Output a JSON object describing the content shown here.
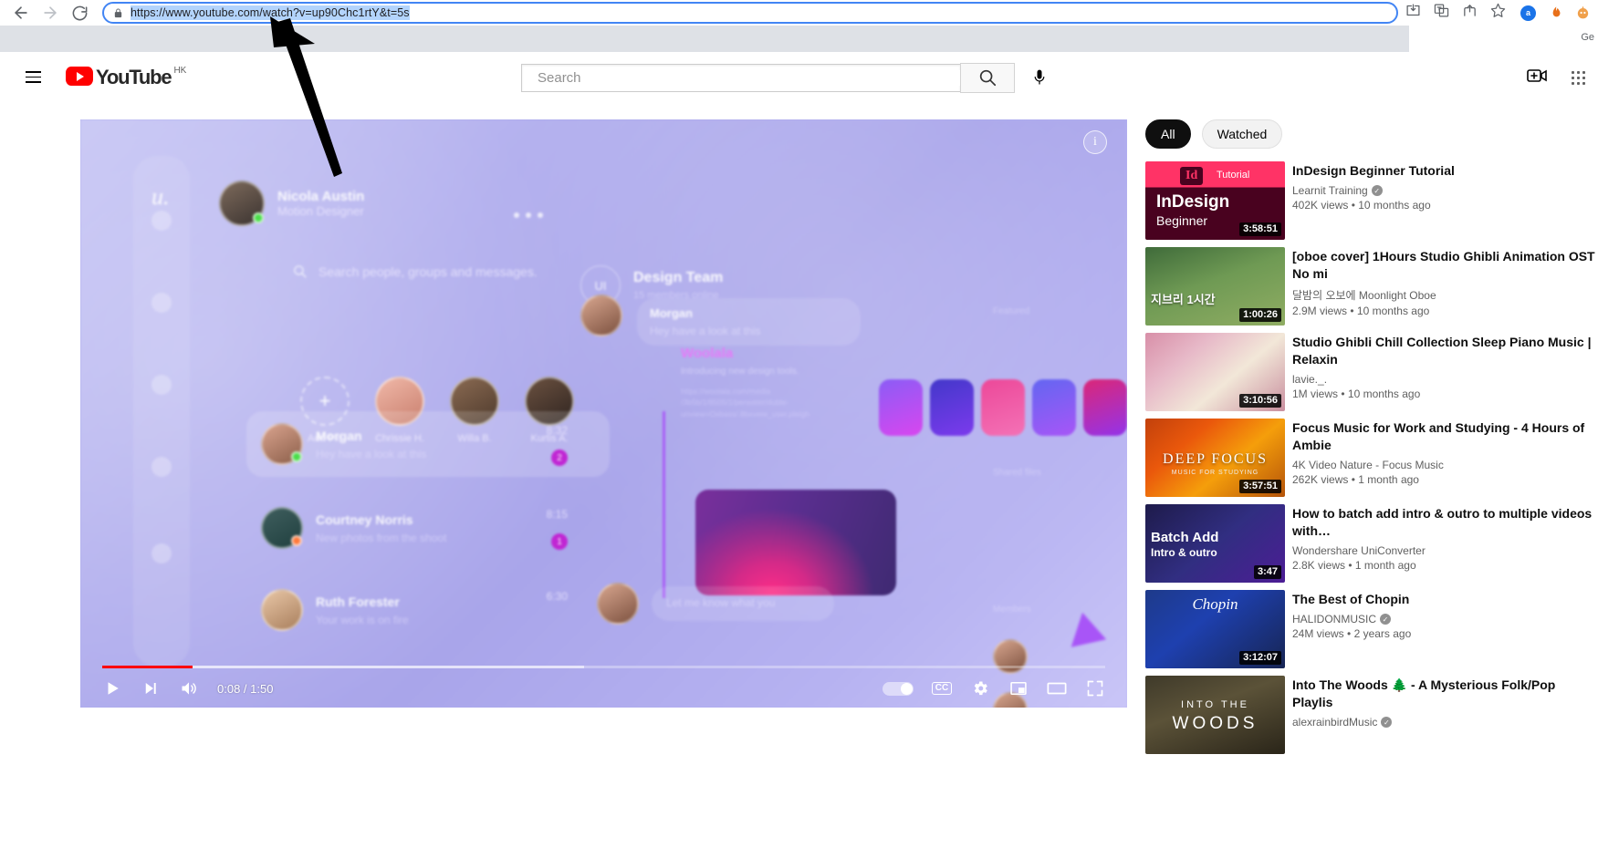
{
  "browser": {
    "url": "https://www.youtube.com/watch?v=up90Chc1rtY&t=5s",
    "back_label": "Back",
    "forward_label": "Forward",
    "reload_label": "Reload",
    "lock_label": "View site information",
    "icons": {
      "install": "install-icon",
      "translate": "translate-icon",
      "share": "share-icon",
      "bookmark": "star-icon",
      "ext_a": "a",
      "ext_s": "ext-flame-icon",
      "ext_o": "ext-robot-icon"
    },
    "strip_text": "Ge"
  },
  "youtube": {
    "logo_text": "YouTube",
    "country_code": "HK",
    "menu_label": "Guide",
    "search": {
      "placeholder": "Search",
      "value": "",
      "button_label": "Search",
      "mic_label": "Search with your voice"
    },
    "create_label": "Create",
    "apps_label": "YouTube apps"
  },
  "player": {
    "time_display": "0:08 / 1:50",
    "current_time": "0:08",
    "duration": "1:50",
    "progress_percent": 9,
    "loaded_percent": 48,
    "play_label": "Play",
    "next_label": "Next",
    "volume_label": "Mute",
    "autoplay_label": "Autoplay is on",
    "captions_label": "CC",
    "settings_label": "Settings",
    "miniplayer_label": "Miniplayer",
    "theater_label": "Theater mode",
    "fullscreen_label": "Full screen",
    "info_label": "i",
    "content": {
      "brand": "u.",
      "profile_name": "Nicola Austin",
      "profile_role": "Motion Designer",
      "search_placeholder": "Search people, groups and messages.",
      "people": [
        {
          "label": "Add Pic"
        },
        {
          "label": "Chrissie H."
        },
        {
          "label": "Willa B."
        },
        {
          "label": "Kurtis A."
        }
      ],
      "chats": [
        {
          "name": "Morgan",
          "preview": "Hey have a look at this",
          "time": "8:32",
          "badge": "2"
        },
        {
          "name": "Courtney Norris",
          "preview": "New photos from the shoot",
          "time": "8:15",
          "badge": "1"
        },
        {
          "name": "Ruth Forester",
          "preview": "Your work is on fire",
          "time": "6:30",
          "badge": ""
        }
      ],
      "thread": {
        "badge": "UI",
        "title": "Design Team",
        "subtitle": "15 members online",
        "message_author": "Morgan",
        "message_text": "Hey have a look at this",
        "brand_name": "Woolala",
        "brand_sub": "Introducing new design tools.",
        "link_lines": "https://woolala.com/media /3b5b/1/8505/1/perwater/duble-unview=Oxbass/.8bxvww_user.pleigh",
        "input_placeholder": "Let me know what you",
        "side_labels": [
          "Featured",
          "Shared files",
          "Members"
        ]
      }
    }
  },
  "sidebar": {
    "chips": [
      {
        "label": "All",
        "active": true
      },
      {
        "label": "Watched",
        "active": false
      }
    ],
    "videos": [
      {
        "title": "InDesign Beginner Tutorial",
        "channel": "Learnit Training",
        "verified": true,
        "views": "402K views",
        "age": "10 months ago",
        "duration": "3:58:51",
        "thumb_class": "t-indesign",
        "thumb_kind": "indesign",
        "thumb_text": {
          "badge": "Id",
          "tutorial": "Tutorial",
          "main": "InDesign",
          "sub": "Beginner"
        }
      },
      {
        "title": "[oboe cover] 1Hours Studio Ghibli Animation OST No mi",
        "channel": "달밤의 오보에 Moonlight Oboe",
        "verified": false,
        "views": "2.9M views",
        "age": "10 months ago",
        "duration": "1:00:26",
        "thumb_class": "t-ghibli",
        "thumb_kind": "ghibli",
        "thumb_text": {
          "main": "지브리 1시간"
        }
      },
      {
        "title": "Studio Ghibli Chill Collection Sleep Piano Music | Relaxin",
        "channel": "lavie._.",
        "verified": false,
        "views": "1M views",
        "age": "10 months ago",
        "duration": "3:10:56",
        "thumb_class": "t-chill",
        "thumb_kind": "plain",
        "thumb_text": {}
      },
      {
        "title": "Focus Music for Work and Studying - 4 Hours of Ambie",
        "channel": "4K Video Nature - Focus Music",
        "verified": false,
        "views": "262K views",
        "age": "1 month ago",
        "duration": "3:57:51",
        "thumb_class": "t-focus",
        "thumb_kind": "focus",
        "thumb_text": {
          "main": "DEEP FOCUS",
          "sub": "MUSIC FOR STUDYING"
        }
      },
      {
        "title": "How to batch add intro & outro to multiple videos with…",
        "channel": "Wondershare UniConverter",
        "verified": false,
        "views": "2.8K views",
        "age": "1 month ago",
        "duration": "3:47",
        "thumb_class": "t-batch",
        "thumb_kind": "batch",
        "thumb_text": {
          "main": "Batch Add",
          "sub": "Intro & outro"
        }
      },
      {
        "title": "The Best of Chopin",
        "channel": "HALIDONMUSIC",
        "verified": true,
        "views": "24M views",
        "age": "2 years ago",
        "duration": "3:12:07",
        "thumb_class": "t-chopin",
        "thumb_kind": "chopin",
        "thumb_text": {
          "main": "Chopin"
        }
      },
      {
        "title": "Into The Woods 🌲 - A Mysterious Folk/Pop Playlis",
        "channel": "alexrainbirdMusic",
        "verified": true,
        "views": "",
        "age": "",
        "duration": "",
        "thumb_class": "t-woods",
        "thumb_kind": "woods",
        "thumb_text": {
          "main": "INTO THE",
          "sub": "WOODS"
        }
      }
    ]
  },
  "annotation": {
    "kind": "arrow",
    "description": "black arrow pointing to the address bar"
  }
}
